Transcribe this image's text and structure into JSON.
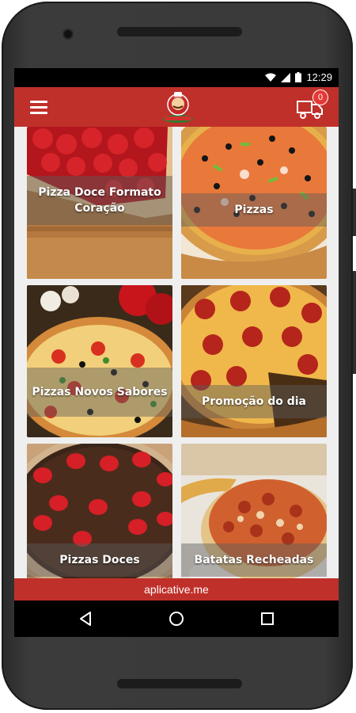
{
  "status": {
    "time": "12:29"
  },
  "header": {
    "menu_icon": "hamburger-menu-icon",
    "logo": "pizzeria-logo",
    "cart_icon": "delivery-cart-icon",
    "cart_count": "0"
  },
  "categories": [
    {
      "label": "Pizza Doce Formato Coração"
    },
    {
      "label": "Pizzas"
    },
    {
      "label": "Pizzas Novos Sabores"
    },
    {
      "label": "Promoção do dia"
    },
    {
      "label": "Pizzas Doces"
    },
    {
      "label": "Batatas Recheadas"
    }
  ],
  "footer": {
    "text": "aplicative.me"
  },
  "colors": {
    "brand": "#c0302a",
    "badge": "#e53935"
  }
}
